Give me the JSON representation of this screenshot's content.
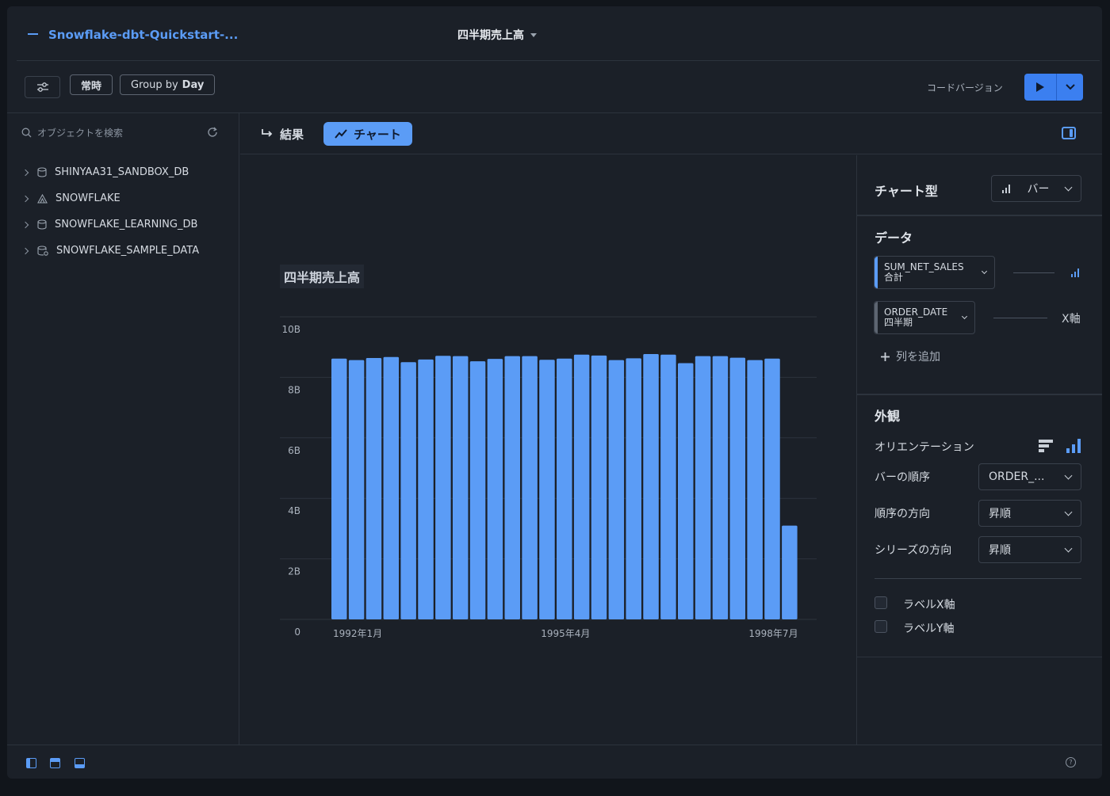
{
  "header": {
    "worksheet_name": "Snowflake-dbt-Quickstart-...",
    "sheet_title": "四半期売上高"
  },
  "toolbar": {
    "filter_always": "常時",
    "group_by_label": "Group by",
    "group_by_value": "Day",
    "code_version": "コードバージョン"
  },
  "sidebar": {
    "search_placeholder": "オブジェクトを検索",
    "items": [
      {
        "label": "SHINYAA31_SANDBOX_DB",
        "icon": "database-icon"
      },
      {
        "label": "SNOWFLAKE",
        "icon": "snowflake-app-icon"
      },
      {
        "label": "SNOWFLAKE_LEARNING_DB",
        "icon": "database-icon"
      },
      {
        "label": "SNOWFLAKE_SAMPLE_DATA",
        "icon": "shared-database-icon"
      }
    ]
  },
  "tabs": {
    "results": "結果",
    "chart": "チャート"
  },
  "chart_data": {
    "type": "bar",
    "title": "四半期売上高",
    "xlabel": "",
    "ylabel": "",
    "ylim": [
      0,
      10000000000
    ],
    "y_ticks": [
      "0",
      "2B",
      "4B",
      "6B",
      "8B",
      "10B"
    ],
    "x_tick_labels": [
      "1992年1月",
      "1995年4月",
      "1998年7月"
    ],
    "categories": [
      "1992 Q1",
      "1992 Q2",
      "1992 Q3",
      "1992 Q4",
      "1993 Q1",
      "1993 Q2",
      "1993 Q3",
      "1993 Q4",
      "1994 Q1",
      "1994 Q2",
      "1994 Q3",
      "1994 Q4",
      "1995 Q1",
      "1995 Q2",
      "1995 Q3",
      "1995 Q4",
      "1996 Q1",
      "1996 Q2",
      "1996 Q3",
      "1996 Q4",
      "1997 Q1",
      "1997 Q2",
      "1997 Q3",
      "1997 Q4",
      "1998 Q1",
      "1998 Q2",
      "1998 Q3"
    ],
    "values": [
      8.62,
      8.57,
      8.64,
      8.67,
      8.5,
      8.59,
      8.71,
      8.7,
      8.53,
      8.61,
      8.7,
      8.7,
      8.58,
      8.62,
      8.75,
      8.72,
      8.57,
      8.63,
      8.77,
      8.75,
      8.47,
      8.7,
      8.7,
      8.65,
      8.57,
      8.62,
      3.1
    ],
    "value_unit": "billions",
    "color": "#5b9cf6",
    "grid": true
  },
  "chart_settings": {
    "chart_type_label": "チャート型",
    "chart_type_value": "バー",
    "data_section": "データ",
    "columns": [
      {
        "name": "SUM_NET_SALES",
        "agg": "合計",
        "role_icon": "bar-chart-icon"
      },
      {
        "name": "ORDER_DATE",
        "agg": "四半期",
        "role": "X軸"
      }
    ],
    "add_column": "列を追加",
    "appearance_section": "外観",
    "orientation_label": "オリエンテーション",
    "bar_order_label": "バーの順序",
    "bar_order_value": "ORDER_...",
    "order_direction_label": "順序の方向",
    "order_direction_value": "昇順",
    "series_direction_label": "シリーズの方向",
    "series_direction_value": "昇順",
    "label_x": "ラベルX軸",
    "label_y": "ラベルY軸"
  },
  "colors": {
    "accent": "#5b9cf6",
    "background": "#1b2028"
  }
}
